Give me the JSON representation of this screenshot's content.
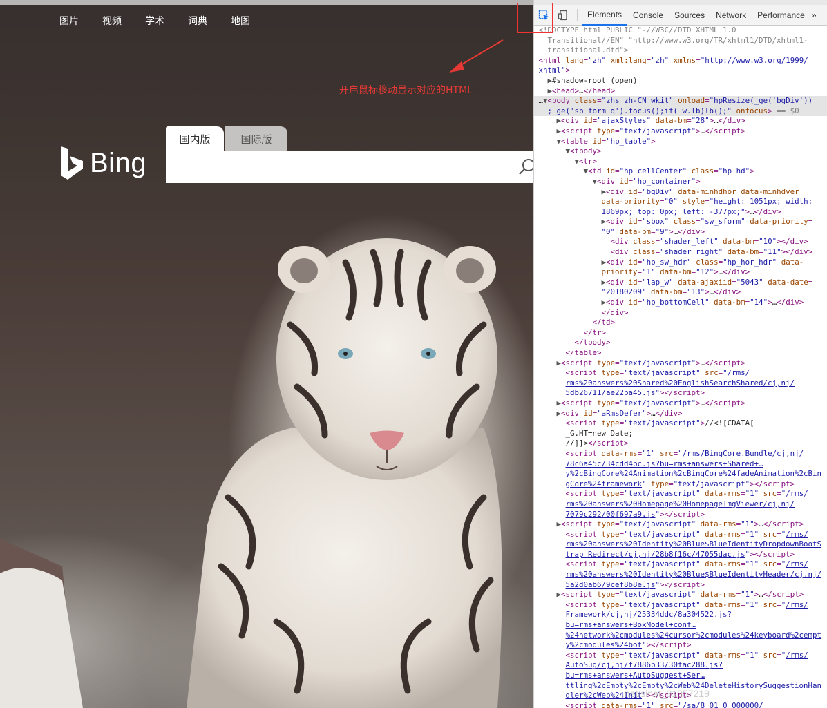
{
  "bing": {
    "nav": [
      "图片",
      "视频",
      "学术",
      "词典",
      "地图"
    ],
    "logo_text": "Bing",
    "tabs": {
      "domestic": "国内版",
      "international": "国际版"
    },
    "search_placeholder": ""
  },
  "annotation": {
    "text": "开启鼠标移动显示对应的HTML",
    "color": "#e53935"
  },
  "devtools": {
    "tabs": [
      "Elements",
      "Console",
      "Sources",
      "Network",
      "Performance"
    ],
    "active_tab": "Elements",
    "more": "»",
    "lines": [
      {
        "i": "",
        "h": "<span class='cm'>&lt;!DOCTYPE html PUBLIC \"-//W3C//DTD XHTML 1.0</span>"
      },
      {
        "i": "  ",
        "h": "<span class='cm'>Transitional//EN\" \"http://www.w3.org/TR/xhtml1/DTD/xhtml1-</span>"
      },
      {
        "i": "  ",
        "h": "<span class='cm'>transitional.dtd\"&gt;</span>"
      },
      {
        "i": "",
        "h": "<span class='tag'>&lt;html</span> <span class='an'>lang</span>=<span class='av'>\"zh\"</span> <span class='an'>xml:lang</span>=<span class='av'>\"zh\"</span> <span class='an'>xmlns</span>=<span class='av'>\"http://www.w3.org/1999/</span>"
      },
      {
        "i": "",
        "h": "<span class='av'>xhtml\"</span><span class='tag'>&gt;</span>"
      },
      {
        "i": "  ",
        "h": "<span class='tri'>▶</span><span class='txt'>#shadow-root (open)</span>"
      },
      {
        "i": "  ",
        "h": "<span class='tri'>▶</span><span class='tag'>&lt;head&gt;</span><span class='txt'>…</span><span class='tag'>&lt;/head&gt;</span>"
      },
      {
        "i": "",
        "sel": true,
        "h": "<span class='txt'>…</span><span class='tri'>▼</span><span class='tag'>&lt;body</span> <span class='an'>class</span>=<span class='av'>\"zhs zh-CN wkit\"</span> <span class='an'>onload</span>=<span class='av'>\"hpResize(_ge('bgDiv'))</span>"
      },
      {
        "i": "  ",
        "sel": true,
        "h": "<span class='av'>;_ge('sb_form_q').focus();if(_w.lb)lb();\"</span> <span class='an'>onfocus</span><span class='tag'>&gt;</span> <span class='cm'>== $0</span>"
      },
      {
        "i": "    ",
        "h": "<span class='tri'>▶</span><span class='tag'>&lt;div</span> <span class='an'>id</span>=<span class='av'>\"ajaxStyles\"</span> <span class='an'>data-bm</span>=<span class='av'>\"28\"</span><span class='tag'>&gt;</span><span class='txt'>…</span><span class='tag'>&lt;/div&gt;</span>"
      },
      {
        "i": "    ",
        "h": "<span class='tri'>▶</span><span class='tag'>&lt;script</span> <span class='an'>type</span>=<span class='av'>\"text/javascript\"</span><span class='tag'>&gt;</span><span class='txt'>…</span><span class='tag'>&lt;/script&gt;</span>"
      },
      {
        "i": "    ",
        "h": "<span class='tri'>▼</span><span class='tag'>&lt;table</span> <span class='an'>id</span>=<span class='av'>\"hp_table\"</span><span class='tag'>&gt;</span>"
      },
      {
        "i": "      ",
        "h": "<span class='tri'>▼</span><span class='tag'>&lt;tbody&gt;</span>"
      },
      {
        "i": "        ",
        "h": "<span class='tri'>▼</span><span class='tag'>&lt;tr&gt;</span>"
      },
      {
        "i": "          ",
        "h": "<span class='tri'>▼</span><span class='tag'>&lt;td</span> <span class='an'>id</span>=<span class='av'>\"hp_cellCenter\"</span> <span class='an'>class</span>=<span class='av'>\"hp_hd\"</span><span class='tag'>&gt;</span>"
      },
      {
        "i": "            ",
        "h": "<span class='tri'>▼</span><span class='tag'>&lt;div</span> <span class='an'>id</span>=<span class='av'>\"hp_container\"</span><span class='tag'>&gt;</span>"
      },
      {
        "i": "              ",
        "h": "<span class='tri'>▶</span><span class='tag'>&lt;div</span> <span class='an'>id</span>=<span class='av'>\"bgDiv\"</span> <span class='an'>data-minhdhor data-minhdver</span>"
      },
      {
        "i": "              ",
        "h": "<span class='an'>data-priority</span>=<span class='av'>\"0\"</span> <span class='an'>style</span>=<span class='av'>\"height: 1051px; width:</span>"
      },
      {
        "i": "              ",
        "h": "<span class='av'>1869px; top: 0px; left: -377px;\"</span><span class='tag'>&gt;</span><span class='txt'>…</span><span class='tag'>&lt;/div&gt;</span>"
      },
      {
        "i": "              ",
        "h": "<span class='tri'>▶</span><span class='tag'>&lt;div</span> <span class='an'>id</span>=<span class='av'>\"sbox\"</span> <span class='an'>class</span>=<span class='av'>\"sw_sform\"</span> <span class='an'>data-priority</span>="
      },
      {
        "i": "              ",
        "h": "<span class='av'>\"0\"</span> <span class='an'>data-bm</span>=<span class='av'>\"9\"</span><span class='tag'>&gt;</span><span class='txt'>…</span><span class='tag'>&lt;/div&gt;</span>"
      },
      {
        "i": "                ",
        "h": "<span class='tag'>&lt;div</span> <span class='an'>class</span>=<span class='av'>\"shader_left\"</span> <span class='an'>data-bm</span>=<span class='av'>\"10\"</span><span class='tag'>&gt;&lt;/div&gt;</span>"
      },
      {
        "i": "                ",
        "h": "<span class='tag'>&lt;div</span> <span class='an'>class</span>=<span class='av'>\"shader_right\"</span> <span class='an'>data-bm</span>=<span class='av'>\"11\"</span><span class='tag'>&gt;&lt;/div&gt;</span>"
      },
      {
        "i": "              ",
        "h": "<span class='tri'>▶</span><span class='tag'>&lt;div</span> <span class='an'>id</span>=<span class='av'>\"hp_sw_hdr\"</span> <span class='an'>class</span>=<span class='av'>\"hp_hor_hdr\"</span> <span class='an'>data-</span>"
      },
      {
        "i": "              ",
        "h": "<span class='an'>priority</span>=<span class='av'>\"1\"</span> <span class='an'>data-bm</span>=<span class='av'>\"12\"</span><span class='tag'>&gt;</span><span class='txt'>…</span><span class='tag'>&lt;/div&gt;</span>"
      },
      {
        "i": "              ",
        "h": "<span class='tri'>▶</span><span class='tag'>&lt;div</span> <span class='an'>id</span>=<span class='av'>\"lap_w\"</span> <span class='an'>data-ajaxiid</span>=<span class='av'>\"5043\"</span> <span class='an'>data-date</span>="
      },
      {
        "i": "              ",
        "h": "<span class='av'>\"20180209\"</span> <span class='an'>data-bm</span>=<span class='av'>\"13\"</span><span class='tag'>&gt;</span><span class='txt'>…</span><span class='tag'>&lt;/div&gt;</span>"
      },
      {
        "i": "              ",
        "h": "<span class='tri'>▶</span><span class='tag'>&lt;div</span> <span class='an'>id</span>=<span class='av'>\"hp_bottomCell\"</span> <span class='an'>data-bm</span>=<span class='av'>\"14\"</span><span class='tag'>&gt;</span><span class='txt'>…</span><span class='tag'>&lt;/div&gt;</span>"
      },
      {
        "i": "              ",
        "h": "<span class='tag'>&lt;/div&gt;</span>"
      },
      {
        "i": "            ",
        "h": "<span class='tag'>&lt;/td&gt;</span>"
      },
      {
        "i": "          ",
        "h": "<span class='tag'>&lt;/tr&gt;</span>"
      },
      {
        "i": "        ",
        "h": "<span class='tag'>&lt;/tbody&gt;</span>"
      },
      {
        "i": "      ",
        "h": "<span class='tag'>&lt;/table&gt;</span>"
      },
      {
        "i": "    ",
        "h": "<span class='tri'>▶</span><span class='tag'>&lt;script</span> <span class='an'>type</span>=<span class='av'>\"text/javascript\"</span><span class='tag'>&gt;</span><span class='txt'>…</span><span class='tag'>&lt;/script&gt;</span>"
      },
      {
        "i": "      ",
        "h": "<span class='tag'>&lt;script</span> <span class='an'>type</span>=<span class='av'>\"text/javascript\"</span> <span class='an'>src</span>=<span class='av'>\"<span class='lnk'>/rms/</span></span>"
      },
      {
        "i": "      ",
        "h": "<span class='lnk'>rms%20answers%20Shared%20EnglishSearchShared/cj,nj/</span>"
      },
      {
        "i": "      ",
        "h": "<span class='lnk'>5db26711/ae22ba45.js</span><span class='av'>\"</span><span class='tag'>&gt;&lt;/script&gt;</span>"
      },
      {
        "i": "    ",
        "h": "<span class='tri'>▶</span><span class='tag'>&lt;script</span> <span class='an'>type</span>=<span class='av'>\"text/javascript\"</span><span class='tag'>&gt;</span><span class='txt'>…</span><span class='tag'>&lt;/script&gt;</span>"
      },
      {
        "i": "    ",
        "h": "<span class='tri'>▶</span><span class='tag'>&lt;div</span> <span class='an'>id</span>=<span class='av'>\"aRmsDefer\"</span><span class='tag'>&gt;</span><span class='txt'>…</span><span class='tag'>&lt;/div&gt;</span>"
      },
      {
        "i": "      ",
        "h": "<span class='tag'>&lt;script</span> <span class='an'>type</span>=<span class='av'>\"text/javascript\"</span><span class='tag'>&gt;</span><span class='txt'>//&lt;![CDATA[</span>"
      },
      {
        "i": "      ",
        "h": "<span class='txt'>_G.HT=new Date;</span>"
      },
      {
        "i": "      ",
        "h": "<span class='txt'>//]]&gt;</span><span class='tag'>&lt;/script&gt;</span>"
      },
      {
        "i": "      ",
        "h": "<span class='tag'>&lt;script</span> <span class='an'>data-rms</span>=<span class='av'>\"1\"</span> <span class='an'>src</span>=<span class='av'>\"<span class='lnk'>/rms/BingCore.Bundle/cj,nj/</span></span>"
      },
      {
        "i": "      ",
        "h": "<span class='lnk'>78c6a45c/34cdd4bc.js?bu=rms+answers+Shared+…</span>"
      },
      {
        "i": "      ",
        "h": "<span class='lnk'>y%2cBingCore%24Animation%2cBingCore%24fadeAnimation%2cBin</span>"
      },
      {
        "i": "      ",
        "h": "<span class='lnk'>gCore%24framework</span><span class='av'>\"</span> <span class='an'>type</span>=<span class='av'>\"text/javascript\"</span><span class='tag'>&gt;&lt;/script&gt;</span>"
      },
      {
        "i": "      ",
        "h": "<span class='tag'>&lt;script</span> <span class='an'>type</span>=<span class='av'>\"text/javascript\"</span> <span class='an'>data-rms</span>=<span class='av'>\"1\"</span> <span class='an'>src</span>=<span class='av'>\"<span class='lnk'>/rms/</span></span>"
      },
      {
        "i": "      ",
        "h": "<span class='lnk'>rms%20answers%20Homepage%20HomepageImgViewer/cj,nj/</span>"
      },
      {
        "i": "      ",
        "h": "<span class='lnk'>7079c292/00f697a9.js</span><span class='av'>\"</span><span class='tag'>&gt;&lt;/script&gt;</span>"
      },
      {
        "i": "    ",
        "h": "<span class='tri'>▶</span><span class='tag'>&lt;script</span> <span class='an'>type</span>=<span class='av'>\"text/javascript\"</span> <span class='an'>data-rms</span>=<span class='av'>\"1\"</span><span class='tag'>&gt;</span><span class='txt'>…</span><span class='tag'>&lt;/script&gt;</span>"
      },
      {
        "i": "      ",
        "h": "<span class='tag'>&lt;script</span> <span class='an'>type</span>=<span class='av'>\"text/javascript\"</span> <span class='an'>data-rms</span>=<span class='av'>\"1\"</span> <span class='an'>src</span>=<span class='av'>\"<span class='lnk'>/rms/</span></span>"
      },
      {
        "i": "      ",
        "h": "<span class='lnk'>rms%20answers%20Identity%20Blue$BlueIdentityDropdownBootS</span>"
      },
      {
        "i": "      ",
        "h": "<span class='lnk'>trap Redirect/cj,nj/28b8f16c/47055dac.js</span><span class='av'>\"</span><span class='tag'>&gt;&lt;/script&gt;</span>"
      },
      {
        "i": "      ",
        "h": "<span class='tag'>&lt;script</span> <span class='an'>type</span>=<span class='av'>\"text/javascript\"</span> <span class='an'>data-rms</span>=<span class='av'>\"1\"</span> <span class='an'>src</span>=<span class='av'>\"<span class='lnk'>/rms/</span></span>"
      },
      {
        "i": "      ",
        "h": "<span class='lnk'>rms%20answers%20Identity%20Blue$BlueIdentityHeader/cj,nj/</span>"
      },
      {
        "i": "      ",
        "h": "<span class='lnk'>5a2d0ab6/9cef8b8e.js</span><span class='av'>\"</span><span class='tag'>&gt;&lt;/script&gt;</span>"
      },
      {
        "i": "    ",
        "h": "<span class='tri'>▶</span><span class='tag'>&lt;script</span> <span class='an'>type</span>=<span class='av'>\"text/javascript\"</span> <span class='an'>data-rms</span>=<span class='av'>\"1\"</span><span class='tag'>&gt;</span><span class='txt'>…</span><span class='tag'>&lt;/script&gt;</span>"
      },
      {
        "i": "      ",
        "h": "<span class='tag'>&lt;script</span> <span class='an'>type</span>=<span class='av'>\"text/javascript\"</span> <span class='an'>data-rms</span>=<span class='av'>\"1\"</span> <span class='an'>src</span>=<span class='av'>\"<span class='lnk'>/rms/</span></span>"
      },
      {
        "i": "      ",
        "h": "<span class='lnk'>Framework/cj,nj/25334ddc/8a304522.js?</span>"
      },
      {
        "i": "      ",
        "h": "<span class='lnk'>bu=rms+answers+BoxModel+conf…</span>"
      },
      {
        "i": "      ",
        "h": "<span class='lnk'>%24network%2cmodules%24cursor%2cmodules%24keyboard%2cempt</span>"
      },
      {
        "i": "      ",
        "h": "<span class='lnk'>y%2cmodules%24bot</span><span class='av'>\"</span><span class='tag'>&gt;&lt;/script&gt;</span>"
      },
      {
        "i": "      ",
        "h": "<span class='tag'>&lt;script</span> <span class='an'>type</span>=<span class='av'>\"text/javascript\"</span> <span class='an'>data-rms</span>=<span class='av'>\"1\"</span> <span class='an'>src</span>=<span class='av'>\"<span class='lnk'>/rms/</span></span>"
      },
      {
        "i": "      ",
        "h": "<span class='lnk'>AutoSug/cj,nj/f7886b33/30fac288.js?</span>"
      },
      {
        "i": "      ",
        "h": "<span class='lnk'>bu=rms+answers+AutoSuggest+Ser…</span>"
      },
      {
        "i": "      ",
        "h": "<span class='lnk'>ttling%2cEmpty%2cEmpty%2cWeb%24DeleteHistorySuggestionHan</span>"
      },
      {
        "i": "      ",
        "h": "<span class='lnk'>dler%2cWeb%24Init</span><span class='av'>\"</span><span class='tag'>&gt;&lt;/script&gt;</span>"
      },
      {
        "i": "      ",
        "h": "<span class='tag'>&lt;script</span> <span class='an'>data-rms</span>=<span class='av'>\"1\"</span> <span class='an'>src</span>=<span class='av'>\"/sa/8_01_0_000000/</span>"
      }
    ]
  },
  "watermark": ".net/sinat_31057219"
}
